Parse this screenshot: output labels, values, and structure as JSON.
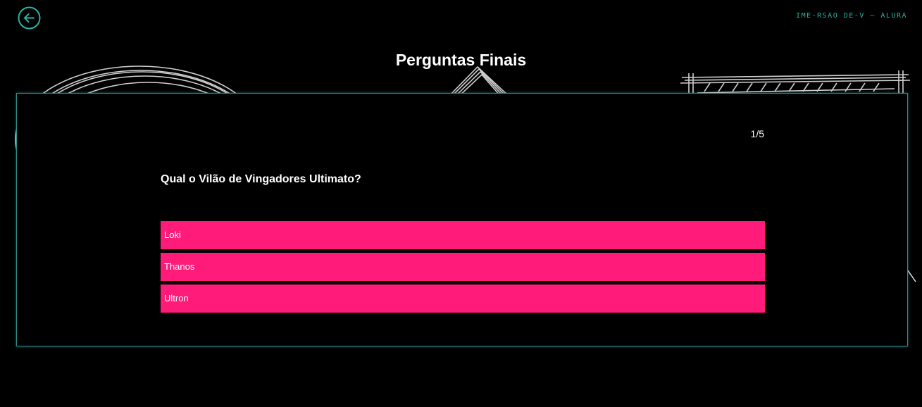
{
  "header": {
    "back_icon": "arrow-left-circle-icon",
    "brand": "IME-RSAO DE-V — ALURA",
    "accent_color": "#2bb3a8"
  },
  "page": {
    "title": "Perguntas Finais"
  },
  "quiz": {
    "counter": "1/5",
    "question": "Qual o Vilão de Vingadores Ultimato?",
    "option_color": "#ff1b79",
    "options": [
      {
        "label": "Loki"
      },
      {
        "label": "Thanos"
      },
      {
        "label": "Ultron"
      }
    ]
  }
}
